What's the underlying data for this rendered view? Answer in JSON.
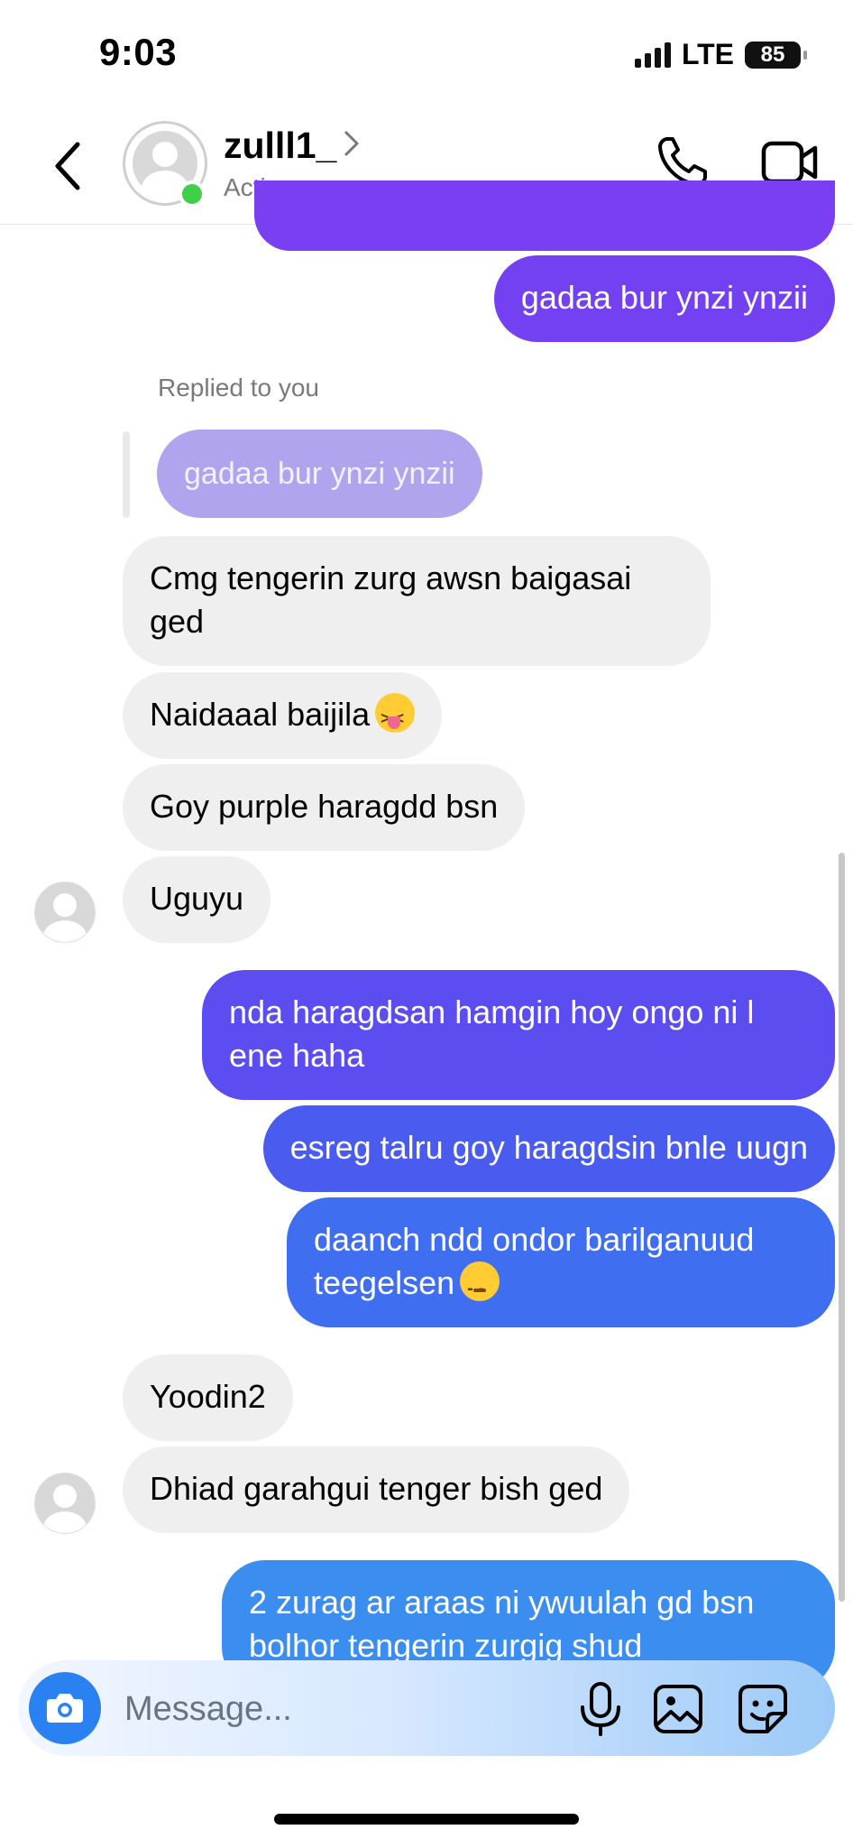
{
  "status_bar": {
    "time": "9:03",
    "network": "LTE",
    "battery": "85"
  },
  "header": {
    "username": "zulll1_",
    "status": "Active now"
  },
  "thread": {
    "outgoing_top": {
      "text": "gadaa bur ynzi ynzii"
    },
    "reply_context": {
      "label": "Replied to you",
      "quoted": "gadaa bur ynzi ynzii"
    },
    "incoming_group_1": [
      {
        "text": "Cmg tengerin zurg awsn baigasai ged"
      },
      {
        "text": "Naidaaal baijila",
        "emoji": "squinting-face-with-tongue"
      },
      {
        "text": "Goy purple haragdd bsn"
      },
      {
        "text": "Uguyu"
      }
    ],
    "outgoing_group_1": [
      {
        "text": "nda haragdsan hamgin hoy ongo ni l ene haha"
      },
      {
        "text": "esreg talru goy haragdsin bnle uugn"
      },
      {
        "text": "daanch ndd ondor barilganuud teegelsen",
        "emoji": "pensive-face"
      }
    ],
    "incoming_group_2": [
      {
        "text": "Yoodin2"
      },
      {
        "text": "Dhiad garahgui tenger bish ged"
      }
    ],
    "outgoing_bottom": {
      "text": "2 zurag ar araas ni ywuulah gd bsn bolhor tengerin zurgig shud"
    }
  },
  "composer": {
    "placeholder": "Message..."
  },
  "colors": {
    "out_purple": "#7341f2",
    "out_violet": "#5b4df0",
    "out_blue": "#3f6ff0",
    "out_sky": "#3b8ef0",
    "in_gray": "#efefef"
  },
  "icons": [
    "back-chevron-icon",
    "call-icon",
    "video-call-icon",
    "camera-icon",
    "microphone-icon",
    "gallery-icon",
    "sticker-icon"
  ]
}
